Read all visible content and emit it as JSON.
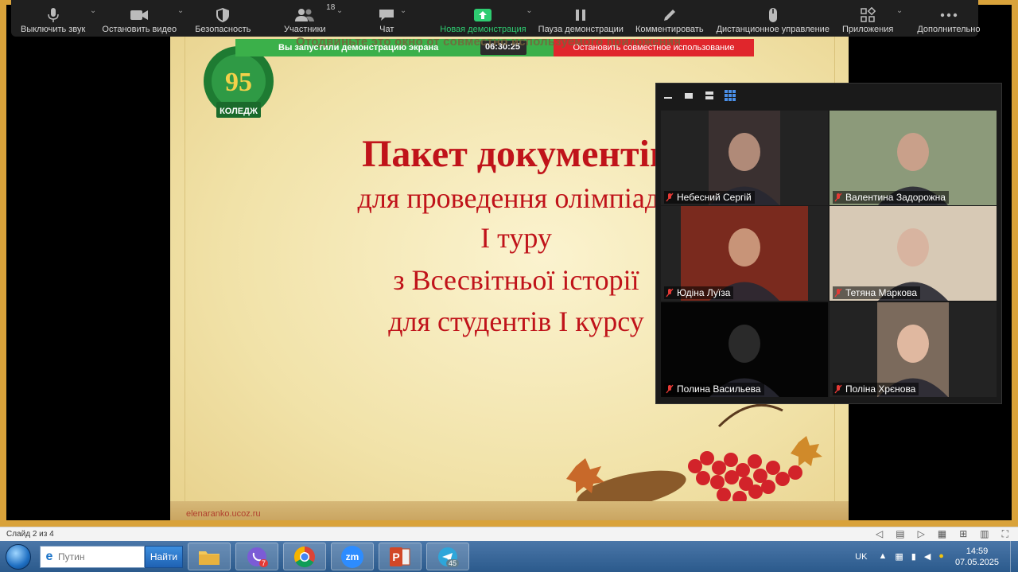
{
  "toolbar": {
    "mute": "Выключить звук",
    "stop_video": "Остановить видео",
    "security": "Безопасность",
    "participants": "Участники",
    "participants_count": "18",
    "chat": "Чат",
    "new_share": "Новая демонстрация",
    "pause_share": "Пауза демонстрации",
    "annotate": "Комментировать",
    "remote_control": "Дистанционное управление",
    "apps": "Приложения",
    "more": "Дополнительно"
  },
  "share_banner": {
    "status": "Вы запустили демонстрацию экрана",
    "timer": "06:30:25",
    "stop": "Остановить совместное использование",
    "drag_hint": "Отодвиньте это окно от совместно используемого приложения"
  },
  "slide": {
    "title": "Пакет документів",
    "line2": "для проведення олімпіади",
    "line3": "І туру",
    "line4": "з Всесвітньої історії",
    "line5": "для студентів І курсу",
    "logo_number": "95",
    "logo_text": "КОЛЕДЖ",
    "url": "elenaranko.ucoz.ru"
  },
  "gallery": {
    "participants": [
      {
        "name": "Небесний Сергій",
        "skin": "#b08a78",
        "bg": "#3a3030"
      },
      {
        "name": "Валентина Задорожна",
        "skin": "#c9a08a",
        "bg": "#8c9a7a"
      },
      {
        "name": "Юдіна Луїза",
        "skin": "#c89478",
        "bg": "#7a2a1e"
      },
      {
        "name": "Тетяна Маркова",
        "skin": "#d8b4a0",
        "bg": "#d7c9b5"
      },
      {
        "name": "Полина Васильева",
        "skin": "#2a2a2a",
        "bg": "#050505"
      },
      {
        "name": "Поліна Хрєнова",
        "skin": "#e0b8a0",
        "bg": "#7b6a5c"
      }
    ]
  },
  "ppt_status": {
    "slide_num": "Слайд 2 из 4"
  },
  "taskbar": {
    "search_placeholder": "Путин",
    "find_label": "Найти",
    "viber_badge": "7",
    "telegram_badge": "45",
    "zoom_label": "zm",
    "lang": "UK",
    "time": "14:59",
    "date": "07.05.2025"
  }
}
